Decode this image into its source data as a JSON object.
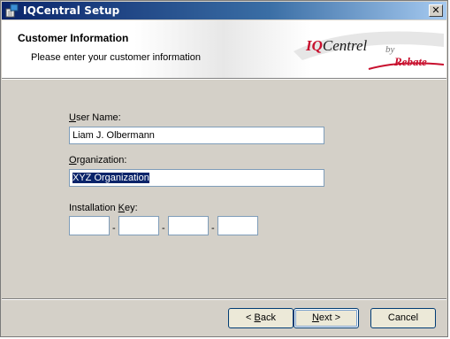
{
  "window": {
    "title": "IQCentral Setup"
  },
  "banner": {
    "title": "Customer Information",
    "subtitle": "Please enter your customer information",
    "logo_brand_iq": "IQ",
    "logo_brand_rest": "Centrel",
    "logo_by": "by",
    "logo_company": "Rebate"
  },
  "form": {
    "user_name_label_key": "U",
    "user_name_label_rest": "ser Name:",
    "user_name_value": "Liam J. Olbermann",
    "organization_label_key": "O",
    "organization_label_rest": "rganization:",
    "organization_value": "XYZ Organization",
    "install_key_label_pre": "Installation ",
    "install_key_label_key": "K",
    "install_key_label_rest": "ey:",
    "key_separator": "-"
  },
  "buttons": {
    "back_key": "B",
    "back_pre": "< ",
    "back_rest": "ack",
    "next_key": "N",
    "next_rest": "ext >",
    "cancel": "Cancel"
  },
  "colors": {
    "title_bar": "#0a246a",
    "selection": "#0a246a",
    "logo_red": "#c8102e"
  }
}
